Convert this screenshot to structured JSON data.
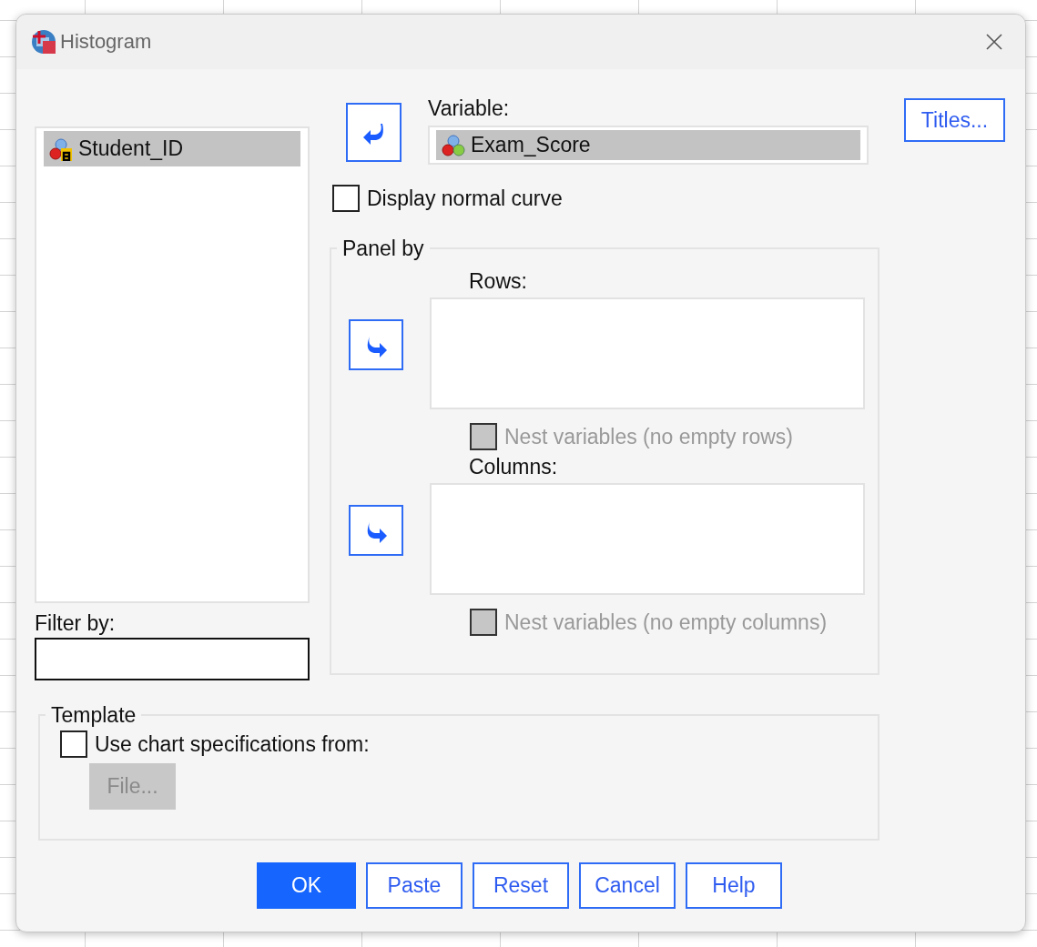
{
  "window": {
    "title": "Histogram"
  },
  "source_list": {
    "items": [
      {
        "name": "Student_ID",
        "kind": "string",
        "selected": true
      }
    ]
  },
  "filter": {
    "label": "Filter by:"
  },
  "variable": {
    "label": "Variable:",
    "item": {
      "name": "Exam_Score",
      "kind": "numeric",
      "selected": true
    }
  },
  "display_normal_curve": {
    "label": "Display normal curve",
    "checked": false
  },
  "titles_button": {
    "label": "Titles..."
  },
  "panel_by": {
    "title": "Panel by",
    "rows": {
      "label": "Rows:",
      "nest": {
        "label": "Nest variables (no empty rows)",
        "checked": false,
        "disabled": true
      }
    },
    "columns": {
      "label": "Columns:",
      "nest": {
        "label": "Nest variables (no empty columns)",
        "checked": false,
        "disabled": true
      }
    }
  },
  "template": {
    "title": "Template",
    "use_spec": {
      "label": "Use chart specifications from:",
      "checked": false
    },
    "file_button": {
      "label": "File...",
      "disabled": true
    }
  },
  "buttons": [
    {
      "label": "OK",
      "default": true
    },
    {
      "label": "Paste",
      "default": false
    },
    {
      "label": "Reset",
      "default": false
    },
    {
      "label": "Cancel",
      "default": false
    },
    {
      "label": "Help",
      "default": false
    }
  ]
}
